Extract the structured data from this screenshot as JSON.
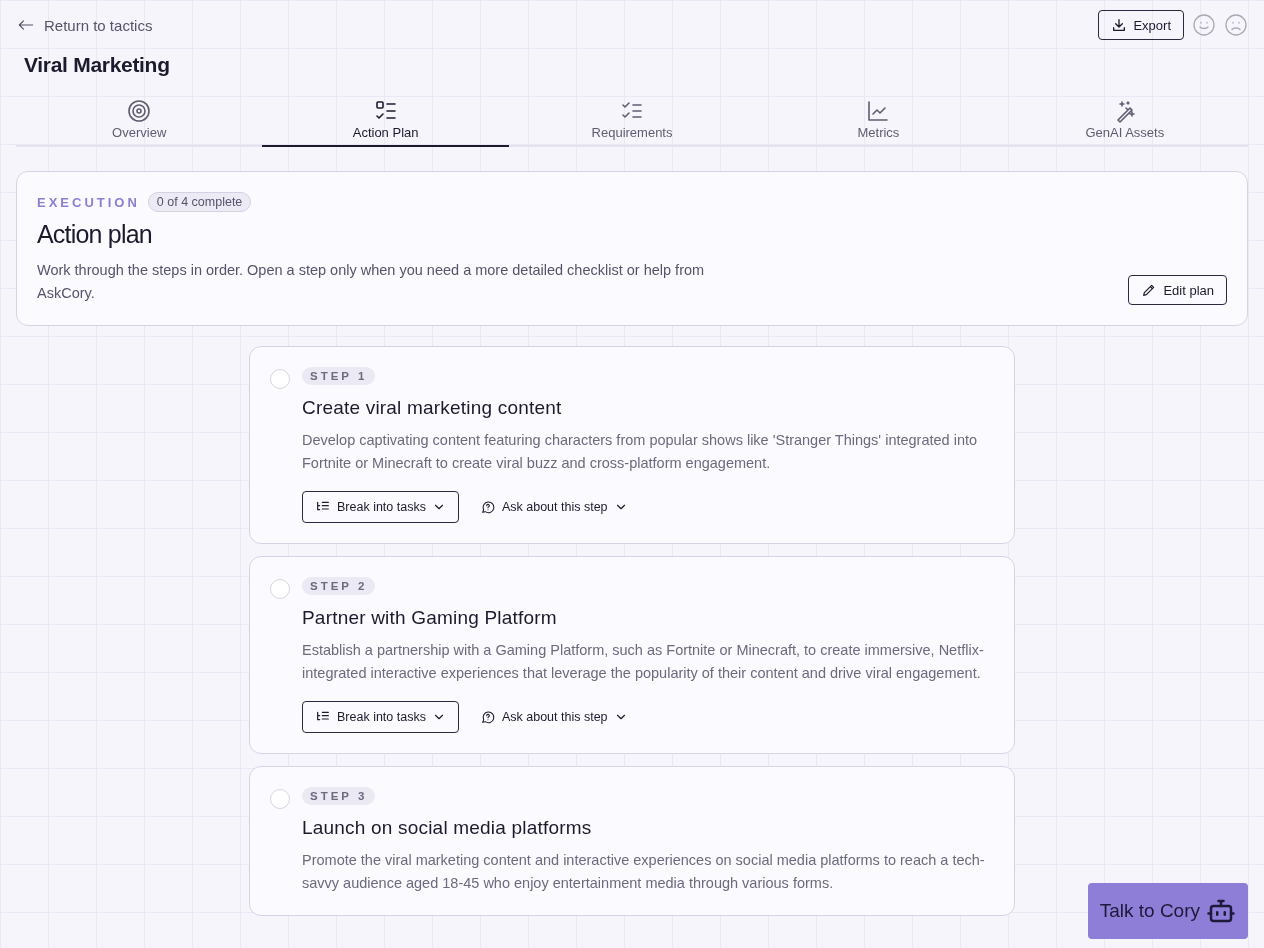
{
  "back_link": "Return to tactics",
  "export_button": "Export",
  "title": "Viral Marketing",
  "tabs": [
    {
      "label": "Overview",
      "selected": false
    },
    {
      "label": "Action Plan",
      "selected": true
    },
    {
      "label": "Requirements",
      "selected": false
    },
    {
      "label": "Metrics",
      "selected": false
    },
    {
      "label": "GenAI Assets",
      "selected": false
    }
  ],
  "header_card": {
    "eyebrow": "EXECUTION",
    "progress_badge": "0 of 4 complete",
    "heading": "Action plan",
    "description": "Work through the steps in order. Open a step only when you need a more detailed checklist or help from AskCory.",
    "edit_button": "Edit plan"
  },
  "steps": [
    {
      "label": "STEP 1",
      "done": false,
      "title": "Create viral marketing content",
      "description": "Develop captivating content featuring characters from popular shows like 'Stranger Things' integrated into Fortnite or Minecraft to create viral buzz and cross-platform engagement.",
      "actions": [
        "Break into tasks",
        "Ask about this step"
      ]
    },
    {
      "label": "STEP 2",
      "done": false,
      "title": "Partner with Gaming Platform",
      "description": "Establish a partnership with a Gaming Platform, such as Fortnite or Minecraft, to create immersive, Netflix-integrated interactive experiences that leverage the popularity of their content and drive viral engagement.",
      "actions": [
        "Break into tasks",
        "Ask about this step"
      ]
    },
    {
      "label": "STEP 3",
      "done": false,
      "title": "Launch on social media platforms",
      "description": "Promote the viral marketing content and interactive experiences on social media platforms to reach a tech-savvy audience aged 18-45 who enjoy entertainment media through various forms."
    }
  ],
  "chat_button": "Talk to Cory"
}
